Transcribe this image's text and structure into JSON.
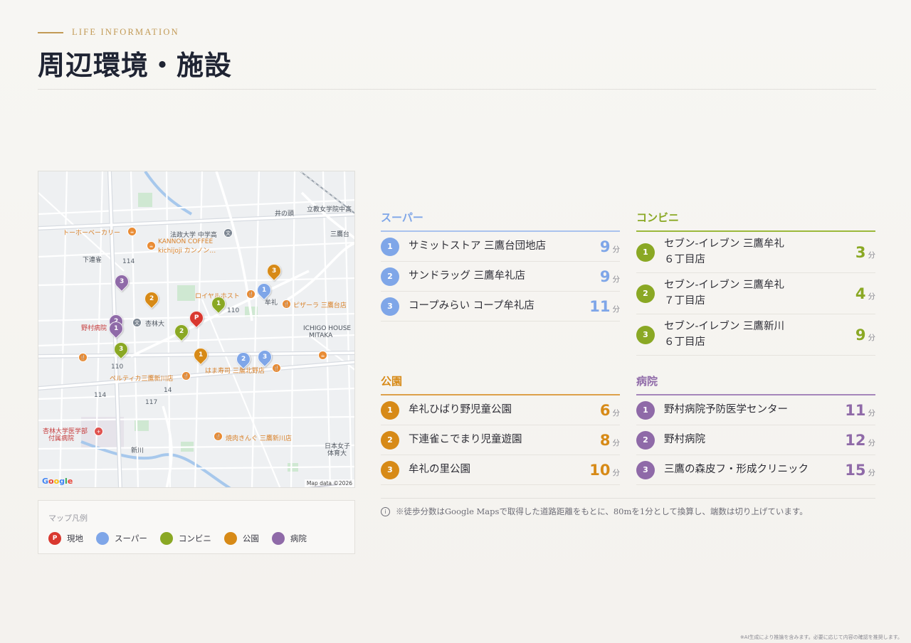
{
  "header": {
    "eyebrow": "LIFE INFORMATION",
    "title": "周辺環境・施設"
  },
  "colors": {
    "accent_gold": "#c29a55",
    "super": "#7fa6e8",
    "convenience": "#8aa824",
    "park": "#d78a17",
    "hospital": "#8f6aa8",
    "site": "#d9382f"
  },
  "map": {
    "labels": {
      "bakery": "トーホーベーカリー",
      "kannon1": "KANNON COFFEE",
      "kannon2": "kichijoji カンノン…",
      "hosei": "法政大学 中学高",
      "shimorenjaku": "下連雀",
      "royal_host": "ロイヤルホスト",
      "mure": "牟礼",
      "pizza": "ピザーラ 三鷹台店",
      "kyorin": "杏林大",
      "nomura": "野村病院",
      "ichigo1": "ICHIGO HOUSE",
      "ichigo2": "MITAKA",
      "hamazushi": "はま寿司 三鷹北野店",
      "pertica": "ペルティカ三鷹新川店",
      "kyorin_hosp1": "杏林大学医学部",
      "kyorin_hosp2": "付属病院",
      "yakiniku": "焼肉きんぐ 三鷹新川店",
      "shinkawa": "新川",
      "nihon_joshi1": "日本女子",
      "nihon_joshi2": "体育大",
      "inokashira": "井の頭",
      "rikkyo": "立教女学院中高",
      "mitakadai": "三鷹台",
      "road_114a": "114",
      "road_114b": "114",
      "road_110a": "110",
      "road_110b": "110",
      "road_14": "14",
      "road_117": "117"
    },
    "attribution": "Map data ©2026",
    "google": [
      "G",
      "o",
      "o",
      "g",
      "l",
      "e"
    ]
  },
  "legend": {
    "title": "マップ凡例",
    "items": [
      {
        "label": "現地",
        "mark": "P"
      },
      {
        "label": "スーパー",
        "mark": ""
      },
      {
        "label": "コンビニ",
        "mark": ""
      },
      {
        "label": "公園",
        "mark": ""
      },
      {
        "label": "病院",
        "mark": ""
      }
    ]
  },
  "categories": {
    "super": {
      "title": "スーパー",
      "unit": "分",
      "items": [
        {
          "num": "1",
          "name": "サミットストア 三鷹台団地店",
          "time": "9"
        },
        {
          "num": "2",
          "name": "サンドラッグ 三鷹牟礼店",
          "time": "9"
        },
        {
          "num": "3",
          "name": "コープみらい コープ牟礼店",
          "time": "11"
        }
      ]
    },
    "convenience": {
      "title": "コンビニ",
      "unit": "分",
      "items": [
        {
          "num": "1",
          "name1": "セブン-イレブン 三鷹牟礼",
          "name2": "６丁目店",
          "time": "3"
        },
        {
          "num": "2",
          "name1": "セブン-イレブン 三鷹牟礼",
          "name2": "７丁目店",
          "time": "4"
        },
        {
          "num": "3",
          "name1": "セブン-イレブン 三鷹新川",
          "name2": "６丁目店",
          "time": "9"
        }
      ]
    },
    "park": {
      "title": "公園",
      "unit": "分",
      "items": [
        {
          "num": "1",
          "name": "牟礼ひばり野児童公園",
          "time": "6"
        },
        {
          "num": "2",
          "name": "下連雀こでまり児童遊園",
          "time": "8"
        },
        {
          "num": "3",
          "name": "牟礼の里公園",
          "time": "10"
        }
      ]
    },
    "hospital": {
      "title": "病院",
      "unit": "分",
      "items": [
        {
          "num": "1",
          "name": "野村病院予防医学センター",
          "time": "11"
        },
        {
          "num": "2",
          "name": "野村病院",
          "time": "12"
        },
        {
          "num": "3",
          "name": "三鷹の森皮フ・形成クリニック",
          "time": "15"
        }
      ]
    }
  },
  "footnote": {
    "icon": "i",
    "text": "※徒歩分数はGoogle Mapsで取得した道路距離をもとに、80mを1分として換算し、端数は切り上げています。"
  },
  "disclaimer": "※AI生成により推論を含みます。必要に応じて内容の確認を推奨します。"
}
